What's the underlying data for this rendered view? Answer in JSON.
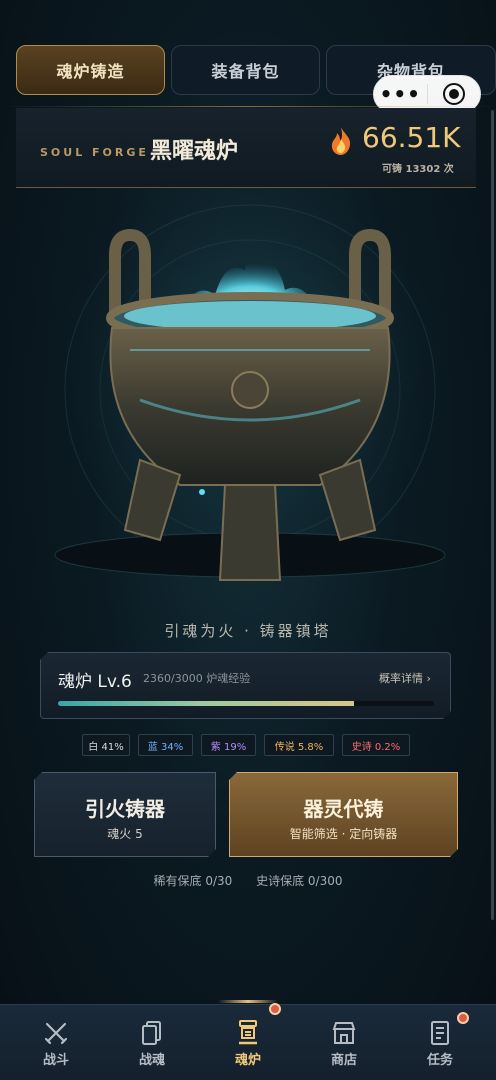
{
  "top_tabs": [
    {
      "label": "魂炉铸造",
      "active": true
    },
    {
      "label": "装备背包",
      "active": false
    },
    {
      "label": "杂物背包",
      "active": false
    }
  ],
  "mini_program": {
    "more_icon": "more-dots-icon",
    "close_icon": "target-close-icon"
  },
  "forge": {
    "subtitle_en": "SOUL FORGE",
    "name": "黑曜魂炉",
    "soul_amount": "66.51K",
    "castable_text": "可铸 13302 次",
    "motto": "引魂为火 · 铸器镇塔"
  },
  "level": {
    "title": "魂炉 Lv.6",
    "exp_text": "2360/3000 炉魂经验",
    "exp_progress": 0.7867,
    "detail_link": "概率详情 ›"
  },
  "rarity_rates": [
    {
      "label": "白 41%",
      "color": "#d8d8d8"
    },
    {
      "label": "蓝 34%",
      "color": "#6fb2ff"
    },
    {
      "label": "紫 19%",
      "color": "#b88aff"
    },
    {
      "label": "传说 5.8%",
      "color": "#f0b35c"
    },
    {
      "label": "史诗 0.2%",
      "color": "#ff6e6e"
    }
  ],
  "actions": {
    "ignite": {
      "title": "引火铸器",
      "sub": "魂火 5"
    },
    "proxy": {
      "title": "器灵代铸",
      "sub": "智能筛选 · 定向铸器"
    }
  },
  "pity": {
    "rare": "稀有保底 0/30",
    "epic": "史诗保底 0/300"
  },
  "tabbar": [
    {
      "label": "战斗",
      "icon": "crossed-swords-icon",
      "active": false,
      "badge": false
    },
    {
      "label": "战魂",
      "icon": "cards-icon",
      "active": false,
      "badge": false
    },
    {
      "label": "魂炉",
      "icon": "cauldron-icon",
      "active": true,
      "badge": true
    },
    {
      "label": "商店",
      "icon": "shop-icon",
      "active": false,
      "badge": false
    },
    {
      "label": "任务",
      "icon": "task-list-icon",
      "active": false,
      "badge": true
    }
  ],
  "colors": {
    "accent_gold": "#f0c87a",
    "panel_dark": "#0f1b26",
    "flame_cyan": "#5fe0f0"
  }
}
